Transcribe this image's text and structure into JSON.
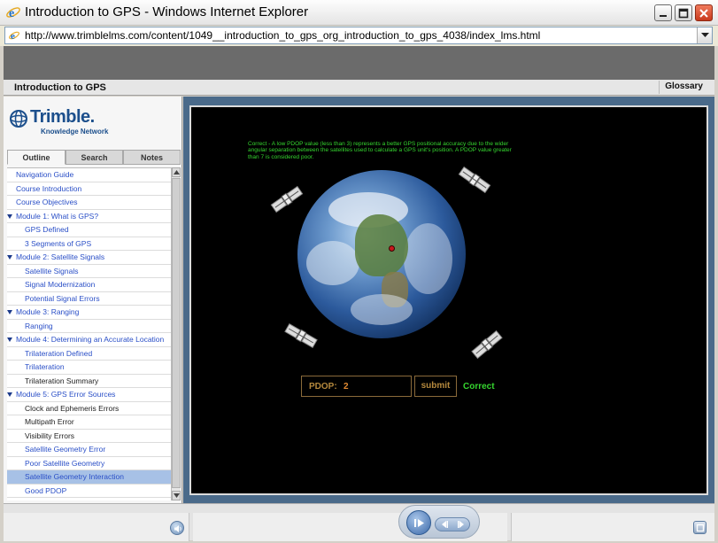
{
  "window": {
    "title": "Introduction to GPS - Windows Internet Explorer",
    "url": "http://www.trimblelms.com/content/1049__introduction_to_gps_org_introduction_to_gps_4038/index_lms.html"
  },
  "course": {
    "title": "Introduction to GPS",
    "glossary_label": "Glossary"
  },
  "logo": {
    "brand": "Trimble.",
    "subtitle": "Knowledge Network"
  },
  "tabs": [
    {
      "label": "Outline"
    },
    {
      "label": "Search"
    },
    {
      "label": "Notes"
    }
  ],
  "outline": [
    {
      "label": "Navigation Guide",
      "level": 1
    },
    {
      "label": "Course Introduction",
      "level": 1
    },
    {
      "label": "Course Objectives",
      "level": 1
    },
    {
      "label": "Module 1: What is GPS?",
      "level": "module"
    },
    {
      "label": "GPS Defined",
      "level": 2
    },
    {
      "label": "3 Segments of GPS",
      "level": 2
    },
    {
      "label": "Module 2: Satellite Signals",
      "level": "module"
    },
    {
      "label": "Satellite Signals",
      "level": 2
    },
    {
      "label": "Signal Modernization",
      "level": 2
    },
    {
      "label": "Potential Signal Errors",
      "level": 2
    },
    {
      "label": "Module 3: Ranging",
      "level": "module"
    },
    {
      "label": "Ranging",
      "level": 2
    },
    {
      "label": "Module 4: Determining an Accurate Location",
      "level": "module"
    },
    {
      "label": "Trilateration Defined",
      "level": 2
    },
    {
      "label": "Trilateration",
      "level": 2
    },
    {
      "label": "Trilateration Summary",
      "level": 2,
      "visited": true
    },
    {
      "label": "Module 5: GPS Error Sources",
      "level": "module"
    },
    {
      "label": "Clock and Ephemeris Errors",
      "level": 2,
      "visited": true
    },
    {
      "label": "Multipath Error",
      "level": 2,
      "visited": true
    },
    {
      "label": "Visibility Errors",
      "level": 2,
      "visited": true
    },
    {
      "label": "Satellite Geometry Error",
      "level": 2
    },
    {
      "label": "Poor Satellite Geometry",
      "level": 2
    },
    {
      "label": "Satellite Geometry Interaction",
      "level": 2,
      "selected": true
    },
    {
      "label": "Good PDOP",
      "level": 2
    }
  ],
  "activity": {
    "feedback": "Correct - A low PDOP value (less than 3) represents a better GPS positional accuracy due to the wider angular separation between the satellites used to calculate a GPS unit's position. A PDOP value greater than 7 is considered poor.",
    "pdop_label": "PDOP:",
    "pdop_value": "2",
    "submit_label": "submit",
    "result": "Correct"
  },
  "icons": {
    "browser": "ie-icon",
    "page": "page-icon",
    "audio": "speaker-icon",
    "play": "play-icon",
    "prev": "previous-icon",
    "next": "next-icon",
    "fullscreen": "fullscreen-icon"
  },
  "colors": {
    "feedback_green": "#35d62f",
    "pdop_label": "#b5893d",
    "pdop_value": "#e28a32",
    "link_blue": "#2a4fc7",
    "selected_bg": "#a7c1e6"
  }
}
